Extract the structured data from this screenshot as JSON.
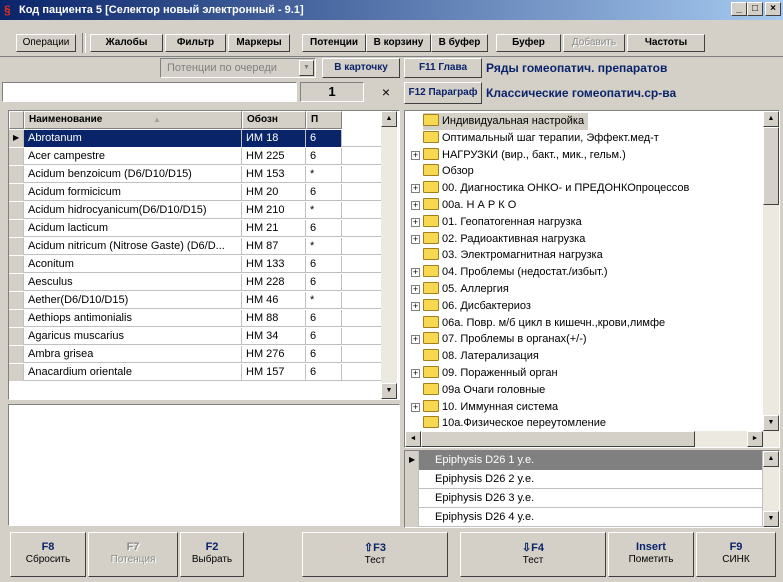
{
  "window": {
    "title": "Код пациента 5   [Селектор новый электронный - 9.1]",
    "min": "_",
    "max": "□",
    "close": "×"
  },
  "toolbar": {
    "operations": "Операции",
    "complaints": "Жалобы",
    "filter": "Фильтр",
    "markers": "Маркеры",
    "potencies": "Потенции",
    "to_cart": "В корзину",
    "to_buffer": "В буфер",
    "buffer": "Буфер",
    "add": "Добавить",
    "frequencies": "Частоты"
  },
  "filter_bar": {
    "potency_combo": "Потенции по очереди",
    "to_card": "В карточку",
    "f11_label": "F11 Глава",
    "f11_text": "Ряды гомеопатич. препаратов",
    "f12_label": "F12 Параграф",
    "f12_text": "Классические гомеопатич.ср-ва",
    "search_value": "",
    "counter": "1",
    "clear": "×"
  },
  "grid": {
    "columns": [
      "Наименование",
      "Обозн",
      "П"
    ],
    "rows": [
      [
        "Abrotanum",
        "ИМ 18",
        "6"
      ],
      [
        "Acer campestre",
        "HM 225",
        "6"
      ],
      [
        "Acidum benzoicum (D6/D10/D15)",
        "HM 153",
        "*"
      ],
      [
        "Acidum formicicum",
        "HM 20",
        "6"
      ],
      [
        "Acidum hidrocyanicum(D6/D10/D15)",
        "HM 210",
        "*"
      ],
      [
        "Acidum lacticum",
        "HM 21",
        "6"
      ],
      [
        "Acidum nitricum (Nitrose Gaste) (D6/D...",
        "HM 87",
        "*"
      ],
      [
        "Aconitum",
        "HM 133",
        "6"
      ],
      [
        "Aesculus",
        "HM 228",
        "6"
      ],
      [
        "Aether(D6/D10/D15)",
        "HM 46",
        "*"
      ],
      [
        "Aethiops antimonialis",
        "HM 88",
        "6"
      ],
      [
        "Agaricus muscarius",
        "HM 34",
        "6"
      ],
      [
        "Ambra grisea",
        "HM 276",
        "6"
      ],
      [
        "Anacardium orientale",
        "HM 157",
        "6"
      ]
    ]
  },
  "tree": {
    "items": [
      {
        "label": "Индивидуальная настройка",
        "expand": false
      },
      {
        "label": "Оптимальный шаг терапии, Эффект.мед-т",
        "expand": false
      },
      {
        "label": "НАГРУЗКИ (вир., бакт., мик., гельм.)",
        "expand": true
      },
      {
        "label": "Обзор",
        "expand": false
      },
      {
        "label": "00. Диагностика ОНКО- и ПРЕДОНКОпроцессов",
        "expand": true
      },
      {
        "label": "00а. Н А Р К О",
        "expand": true
      },
      {
        "label": "01. Геопатогенная нагрузка",
        "expand": true
      },
      {
        "label": "02. Радиоактивная нагрузка",
        "expand": true
      },
      {
        "label": "03. Электромагнитная нагрузка",
        "expand": false
      },
      {
        "label": "04. Проблемы (недостат./избыт.)",
        "expand": true
      },
      {
        "label": "05. Аллергия",
        "expand": true
      },
      {
        "label": "06. Дисбактериоз",
        "expand": true
      },
      {
        "label": "06а. Повр. м/б цикл в кишечн.,крови,лимфе",
        "expand": false
      },
      {
        "label": "07. Проблемы в органах(+/-)",
        "expand": true
      },
      {
        "label": "08. Латерализация",
        "expand": false
      },
      {
        "label": "09. Пораженный орган",
        "expand": true
      },
      {
        "label": "09а Очаги головные",
        "expand": false
      },
      {
        "label": "10. Иммунная система",
        "expand": true
      },
      {
        "label": "10а.Физическое перeутомление",
        "expand": false
      }
    ]
  },
  "items_list": [
    "Epiphysis D26 1 у.е.",
    "Epiphysis D26 2 у.е.",
    "Epiphysis D26 3 у.е.",
    "Epiphysis D26 4 у.е."
  ],
  "fkeys": {
    "f8_key": "F8",
    "f8_label": "Сбросить",
    "f7_key": "F7",
    "f7_label": "Потенция",
    "f2_key": "F2",
    "f2_label": "Выбрать",
    "f3_key": "⇧F3",
    "f3_label": "Тест",
    "f4_key": "⇩F4",
    "f4_label": "Тест",
    "ins_key": "Insert",
    "ins_label": "Пометить",
    "f9_key": "F9",
    "f9_label": "СИНК"
  },
  "colors": {
    "selection": "#0a246a",
    "title_start": "#0a246a",
    "title_end": "#a6caf0",
    "folder": "#f8d850",
    "face": "#d4d0c8"
  }
}
